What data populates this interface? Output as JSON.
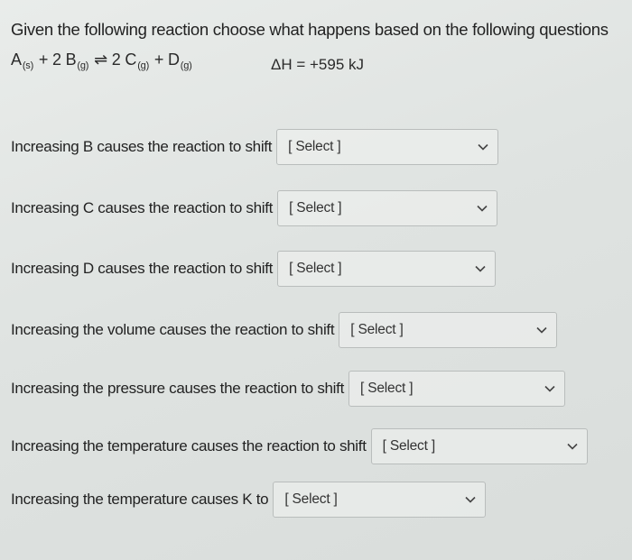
{
  "intro": "Given the following reaction choose what happens based on the following questions",
  "equation": {
    "species": [
      {
        "prefix": "",
        "name": "A",
        "state": "(s)"
      },
      {
        "prefix": "+ 2 ",
        "name": "B",
        "state": "(g)"
      },
      {
        "prefix": "⇌ 2 ",
        "name": "C",
        "state": "(g)"
      },
      {
        "prefix": "+ ",
        "name": "D",
        "state": "(g)"
      }
    ],
    "enthalpy": "ΔH = +595 kJ"
  },
  "questions": [
    {
      "label": "Increasing B causes the reaction to shift",
      "selected": "[ Select ]"
    },
    {
      "label": "Increasing C causes the reaction to shift",
      "selected": "[ Select ]"
    },
    {
      "label": "Increasing D causes the reaction to shift",
      "selected": "[ Select ]"
    },
    {
      "label": "Increasing the volume causes the reaction to shift",
      "selected": "[ Select ]"
    },
    {
      "label": "Increasing the pressure causes the reaction to shift",
      "selected": "[ Select ]"
    },
    {
      "label": "Increasing the temperature causes the reaction to shift",
      "selected": "[ Select ]"
    },
    {
      "label": "Increasing the temperature causes K to",
      "selected": "[ Select ]"
    }
  ],
  "icons": {
    "dropdown": "chevron-down-icon"
  }
}
